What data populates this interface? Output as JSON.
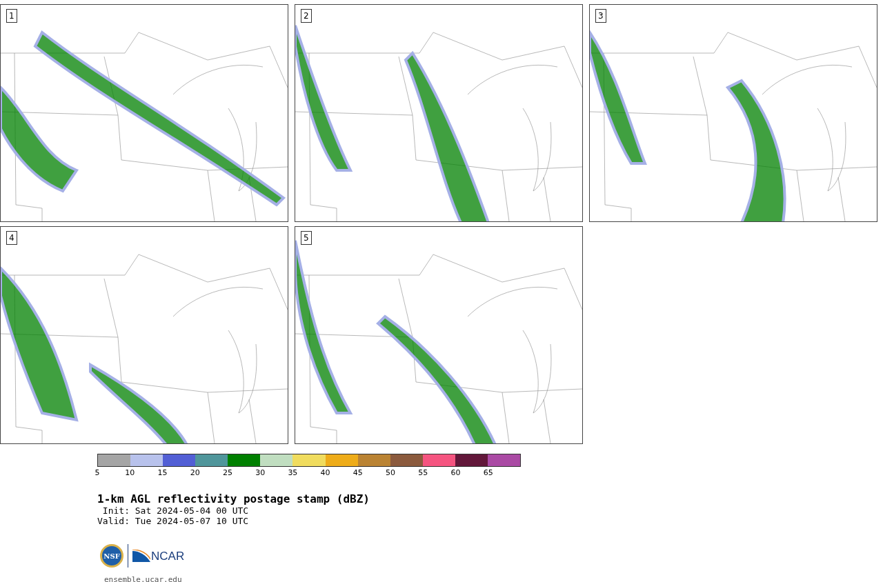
{
  "panels": [
    {
      "label": "1"
    },
    {
      "label": "2"
    },
    {
      "label": "3"
    },
    {
      "label": "4"
    },
    {
      "label": "5"
    }
  ],
  "colorbar": {
    "bins": [
      {
        "color": "#a5a5a5"
      },
      {
        "color": "#b8c2ec"
      },
      {
        "color": "#525fd5"
      },
      {
        "color": "#50969b"
      },
      {
        "color": "#008000"
      },
      {
        "color": "#c0dec0"
      },
      {
        "color": "#f0dc5e"
      },
      {
        "color": "#eeac19"
      },
      {
        "color": "#ba8333"
      },
      {
        "color": "#8b5a3d"
      },
      {
        "color": "#f55480"
      },
      {
        "color": "#62173a"
      },
      {
        "color": "#aa4aa4"
      }
    ],
    "ticks": [
      "5",
      "10",
      "15",
      "20",
      "25",
      "30",
      "35",
      "40",
      "45",
      "50",
      "55",
      "60",
      "65"
    ]
  },
  "title": "1-km AGL reflectivity postage stamp (dBZ)",
  "init": " Init: Sat 2024-05-04 00 UTC",
  "valid": "Valid: Tue 2024-05-07 10 UTC",
  "logo": {
    "left": "NSF",
    "right": "NCAR"
  },
  "footer": "ensemble.ucar.edu"
}
